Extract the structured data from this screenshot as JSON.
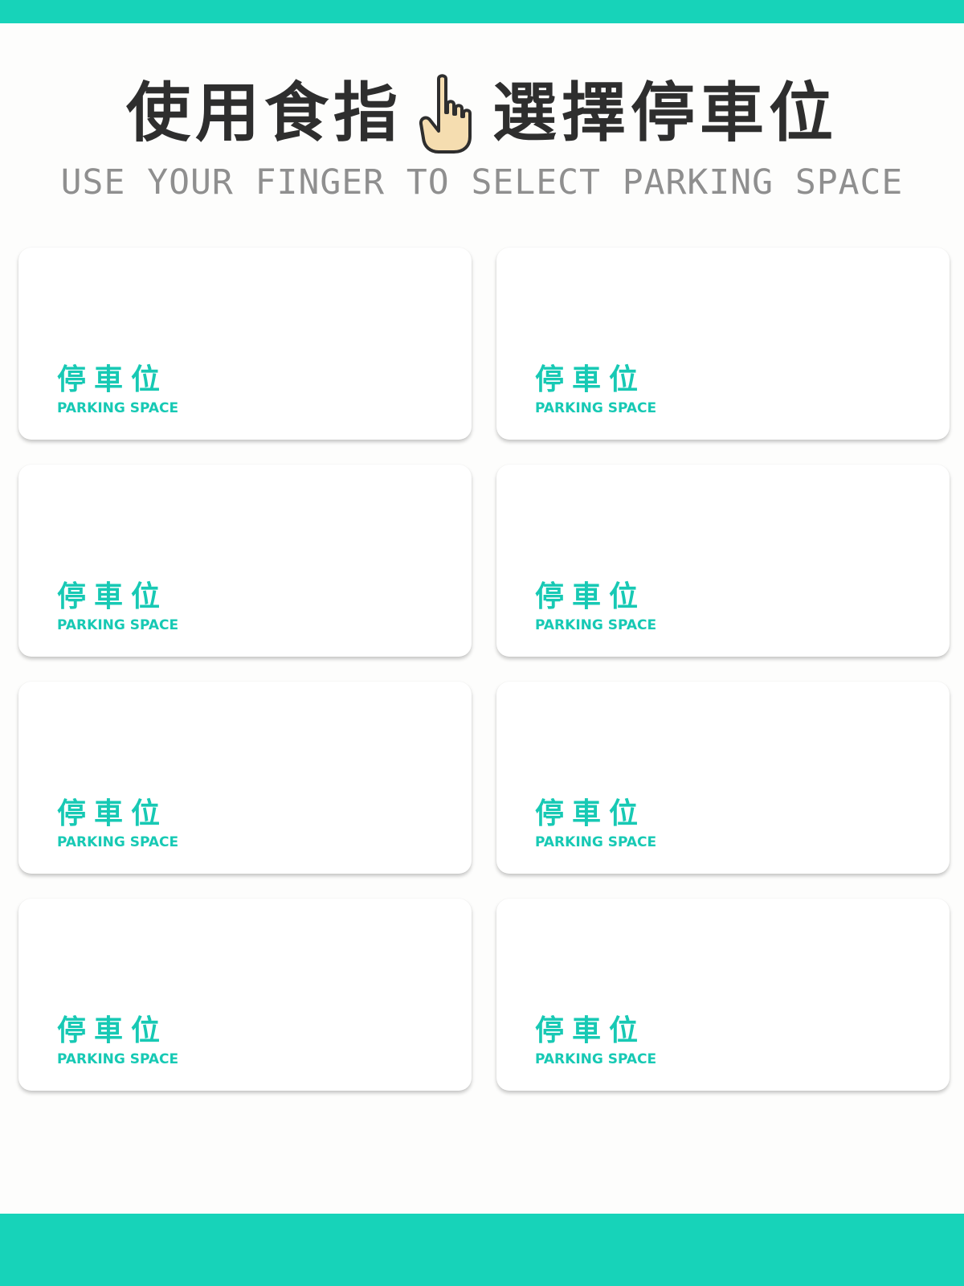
{
  "header": {
    "title_before_icon": "使用食指",
    "title_after_icon": "選擇停車位",
    "subtitle": "USE YOUR FINGER TO SELECT PARKING SPACE",
    "icon": "pointing-hand-icon"
  },
  "colors": {
    "accent": "#17d3b9",
    "title_text": "#2e2e2e",
    "subtitle_text": "#8f8f8f",
    "card_text": "#17c9b4",
    "hand_fill": "#f5ddb0"
  },
  "parking_spaces": [
    {
      "label_zh": "停車位",
      "label_en": "PARKING SPACE"
    },
    {
      "label_zh": "停車位",
      "label_en": "PARKING SPACE"
    },
    {
      "label_zh": "停車位",
      "label_en": "PARKING SPACE"
    },
    {
      "label_zh": "停車位",
      "label_en": "PARKING SPACE"
    },
    {
      "label_zh": "停車位",
      "label_en": "PARKING SPACE"
    },
    {
      "label_zh": "停車位",
      "label_en": "PARKING SPACE"
    },
    {
      "label_zh": "停車位",
      "label_en": "PARKING SPACE"
    },
    {
      "label_zh": "停車位",
      "label_en": "PARKING SPACE"
    }
  ]
}
